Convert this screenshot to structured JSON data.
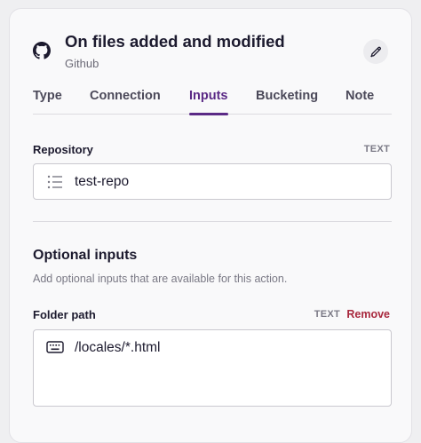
{
  "header": {
    "title": "On files added and modified",
    "subtitle": "Github",
    "icon": "github-icon",
    "edit_icon": "pencil-icon"
  },
  "tabs": [
    {
      "label": "Type",
      "active": false
    },
    {
      "label": "Connection",
      "active": false
    },
    {
      "label": "Inputs",
      "active": true
    },
    {
      "label": "Bucketing",
      "active": false
    },
    {
      "label": "Note",
      "active": false
    }
  ],
  "repository": {
    "label": "Repository",
    "type": "TEXT",
    "value": "test-repo",
    "icon": "list-icon"
  },
  "optional": {
    "title": "Optional inputs",
    "description": "Add optional inputs that are available for this action."
  },
  "folder_path": {
    "label": "Folder path",
    "type": "TEXT",
    "remove_label": "Remove",
    "value": "/locales/*.html",
    "icon": "keyboard-icon"
  },
  "colors": {
    "accent": "#5b2a86",
    "remove": "#a8283d"
  }
}
